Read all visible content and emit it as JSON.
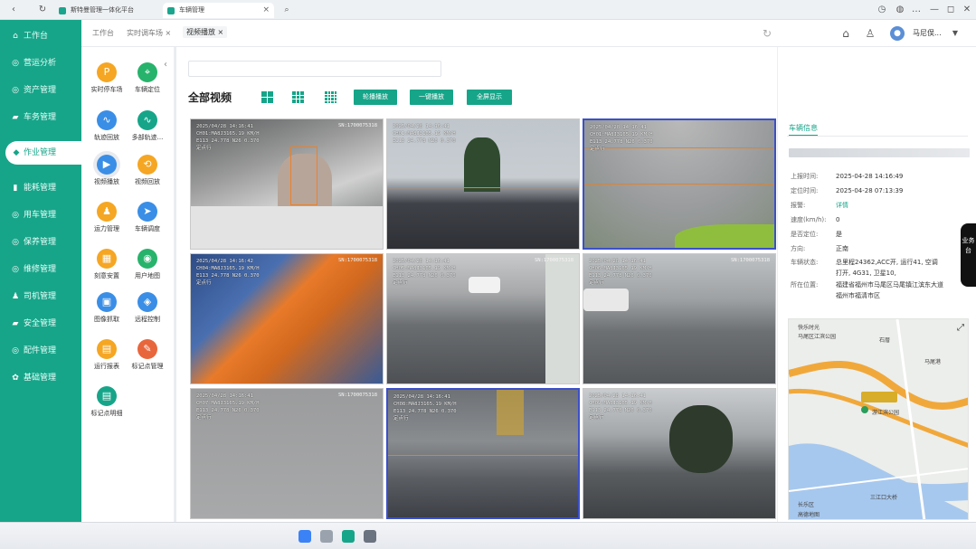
{
  "browser": {
    "tabs": [
      {
        "title": "斯特曼管理一体化平台",
        "active": false
      },
      {
        "title": "车辆管理",
        "active": true
      }
    ],
    "new_tab_icon": "search-icon",
    "window_controls": [
      "…",
      "—",
      "◻",
      "✕"
    ]
  },
  "header": {
    "breadcrumbs": [
      {
        "label": "工作台",
        "closable": false
      },
      {
        "label": "实时调车场",
        "closable": true
      },
      {
        "label": "视频播放",
        "closable": true
      }
    ],
    "user_name": "马尼俣...",
    "icons": [
      "refresh-icon",
      "home-icon",
      "shirt-icon",
      "avatar",
      "dropdown-icon"
    ]
  },
  "sidebar": {
    "items": [
      {
        "label": "工作台",
        "icon": "home-icon",
        "active": false
      },
      {
        "label": "营运分析",
        "icon": "analysis-icon",
        "active": false
      },
      {
        "label": "资产管理",
        "icon": "asset-icon",
        "active": false
      },
      {
        "label": "车务管理",
        "icon": "car-icon",
        "active": false
      },
      {
        "label": "作业管理",
        "icon": "operation-icon",
        "active": true
      },
      {
        "label": "能耗管理",
        "icon": "energy-icon",
        "active": false
      },
      {
        "label": "用车管理",
        "icon": "vehicle-use-icon",
        "active": false
      },
      {
        "label": "保养管理",
        "icon": "maintenance-icon",
        "active": false
      },
      {
        "label": "维修管理",
        "icon": "repair-icon",
        "active": false
      },
      {
        "label": "司机管理",
        "icon": "driver-icon",
        "active": false
      },
      {
        "label": "安全管理",
        "icon": "safety-icon",
        "active": false
      },
      {
        "label": "配件管理",
        "icon": "parts-icon",
        "active": false
      },
      {
        "label": "基础管理",
        "icon": "settings-icon",
        "active": false
      }
    ]
  },
  "functions": {
    "items": [
      {
        "label": "实时停车场",
        "icon": "parking-icon",
        "color": "#f5a623"
      },
      {
        "label": "车辆定位",
        "icon": "location-icon",
        "color": "#27b36b"
      },
      {
        "label": "轨迹回放",
        "icon": "track-replay-icon",
        "color": "#3a8ee6"
      },
      {
        "label": "多部轨迹...",
        "icon": "multi-track-icon",
        "color": "#17a589"
      },
      {
        "label": "视频播放",
        "icon": "video-play-icon",
        "color": "#3a8ee6",
        "selected": true
      },
      {
        "label": "视频回放",
        "icon": "video-replay-icon",
        "color": "#f5a623"
      },
      {
        "label": "运力管理",
        "icon": "capacity-icon",
        "color": "#f5a623"
      },
      {
        "label": "车辆调度",
        "icon": "dispatch-icon",
        "color": "#3a8ee6"
      },
      {
        "label": "刻意安置",
        "icon": "placement-icon",
        "color": "#f5a623"
      },
      {
        "label": "用户地图",
        "icon": "user-map-icon",
        "color": "#27b36b"
      },
      {
        "label": "图像抓取",
        "icon": "image-capture-icon",
        "color": "#3a8ee6"
      },
      {
        "label": "远程控制",
        "icon": "remote-control-icon",
        "color": "#3a8ee6"
      },
      {
        "label": "运行报表",
        "icon": "report-icon",
        "color": "#f5a623"
      },
      {
        "label": "标记点管理",
        "icon": "marker-icon",
        "color": "#e8663c"
      },
      {
        "label": "标记点明细",
        "icon": "marker-detail-icon",
        "color": "#17a589"
      }
    ]
  },
  "main": {
    "title": "全部视频",
    "layout_icons": [
      "grid-2x2-icon",
      "grid-3x3-icon",
      "grid-4x4-icon"
    ],
    "buttons": [
      "轮播播放",
      "一键播放",
      "全屏显示"
    ],
    "videos": [
      {
        "overlay": "2025/04/28 14:16:41\nCH01:MA8J3165.19 KM/H\nE113 24.778 N26 0.370\n定点行",
        "sn": "SN:1700075318",
        "scene": "driver",
        "selected": false
      },
      {
        "overlay": "2025/04/28 14:16:41\nCH01:MA8J3165.19 KM/H\nE113 24.778 N26 0.370",
        "sn": "",
        "scene": "street-palms",
        "selected": false
      },
      {
        "overlay": "2025/04/28 14:16:41\nCH01:MA8J3165.19 KM/H\nE113 24.778 N26 0.370\n定点行",
        "sn": "",
        "scene": "door",
        "selected": true
      },
      {
        "overlay": "2025/04/28 14:16:42\nCH04:MA8J3165.19 KM/H\nE113 24.778 N26 0.370\n定点行",
        "sn": "SN:1700075318",
        "scene": "passenger",
        "selected": false
      },
      {
        "overlay": "2025/04/28 14:16:41\nCH05:MA8J3165.19 KM/H\nE113 24.778 N26 0.370\n定点行",
        "sn": "SN:1700075318",
        "scene": "road-right",
        "selected": false
      },
      {
        "overlay": "2025/04/28 14:16:41\nCH06:MA8J3165.19 KM/H\nE113 24.778 N26 0.370\n定点行",
        "sn": "SN:1700075318",
        "scene": "crossing",
        "selected": false
      },
      {
        "overlay": "2025/04/28 14:16:41\nCH07:MA8J3165.19 KM/H\nE113 24.778 N26 0.370\n定点行",
        "sn": "SN:1700075318",
        "scene": "grey",
        "selected": false
      },
      {
        "overlay": "2025/04/28 14:16:41\nCH08:MA8J3165.19 KM/H\nE113 24.778 N26 0.370\n定点行",
        "sn": "",
        "scene": "sidewalk",
        "selected": true
      },
      {
        "overlay": "2025/04/28 14:16:41\nCH09:MA8J3165.19 KM/H\nE113 24.778 N26 0.370\n定点行",
        "sn": "",
        "scene": "city-tree",
        "selected": false
      }
    ]
  },
  "info": {
    "tab": "车辆信息",
    "rows": [
      {
        "label": "上报时间:",
        "value": "2025-04-28 14:16:49",
        "link": false
      },
      {
        "label": "定位时间:",
        "value": "2025-04-28 07:13:39",
        "link": false
      },
      {
        "label": "报警:",
        "value": "详情",
        "link": true
      },
      {
        "label": "速度(km/h):",
        "value": "0",
        "link": false
      },
      {
        "label": "是否定位:",
        "value": "是",
        "link": false
      },
      {
        "label": "方向:",
        "value": "正南",
        "link": false
      },
      {
        "label": "车辆状态:",
        "value": "总里程24362,ACC开, 运行41, 空调",
        "link": false
      },
      {
        "label": "",
        "value": "打开, 4G31, 卫星10,",
        "link": false
      },
      {
        "label": "所在位置:",
        "value": "福建省福州市马尾区马尾镇江滨东大道",
        "link": false
      },
      {
        "label": "",
        "value": "福州市福清市区",
        "link": false
      }
    ],
    "map_labels": [
      "快乐时光",
      "马尾区江滨公园",
      "石厝",
      "马尾港",
      "游江滨公园",
      "三江口大桥",
      "长乐区",
      "高德地图"
    ],
    "map_expand_icon": "expand-icon"
  },
  "side_tab": "业务台",
  "colors": {
    "accent": "#17a589",
    "selection": "#3b50c9"
  }
}
